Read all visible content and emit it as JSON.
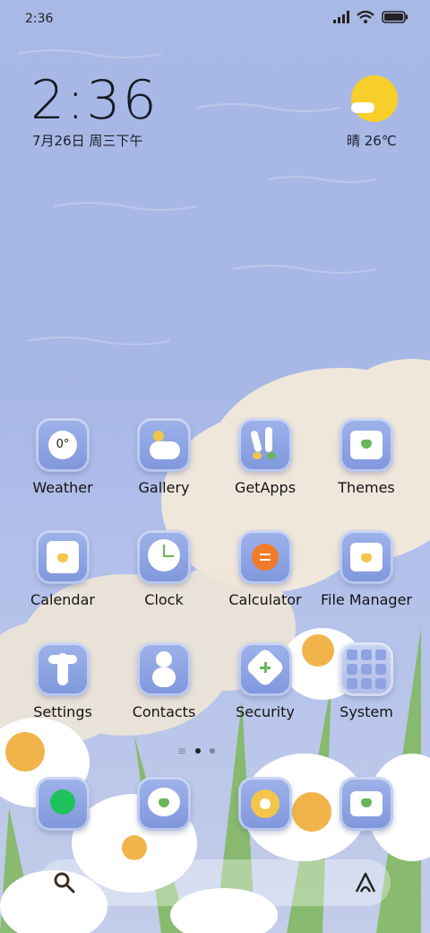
{
  "status_bar": {
    "time": "2:36",
    "icons": [
      "signal-icon",
      "wifi-icon",
      "battery-icon"
    ]
  },
  "clock_widget": {
    "time": "2:36",
    "date": "7月26日 周三下午"
  },
  "weather_widget": {
    "text": "晴 26℃",
    "icon": "sunny-cloud-icon"
  },
  "apps": [
    {
      "label": "Weather",
      "icon": "weather-icon"
    },
    {
      "label": "Gallery",
      "icon": "gallery-icon"
    },
    {
      "label": "GetApps",
      "icon": "getapps-icon"
    },
    {
      "label": "Themes",
      "icon": "themes-icon"
    },
    {
      "label": "Calendar",
      "icon": "calendar-icon"
    },
    {
      "label": "Clock",
      "icon": "clock-icon"
    },
    {
      "label": "Calculator",
      "icon": "calculator-icon"
    },
    {
      "label": "File Manager",
      "icon": "folder-icon"
    },
    {
      "label": "Settings",
      "icon": "settings-icon"
    },
    {
      "label": "Contacts",
      "icon": "contacts-icon"
    },
    {
      "label": "Security",
      "icon": "security-icon"
    },
    {
      "label": "System",
      "icon": "system-folder-icon"
    }
  ],
  "weather_icon_text": "0°",
  "page_indicator": {
    "pages": 2,
    "current": 1
  },
  "dock": [
    {
      "icon": "phone-icon"
    },
    {
      "icon": "messages-icon"
    },
    {
      "icon": "browser-icon"
    },
    {
      "icon": "camera-icon"
    }
  ],
  "search_bar": {
    "left_icon": "search-icon",
    "right_icon": "assistant-icon"
  },
  "colors": {
    "sun": "#f8cf2a",
    "calculator": "#f07b2a",
    "phone": "#1fc35d",
    "accent_green": "#6ab55a"
  }
}
